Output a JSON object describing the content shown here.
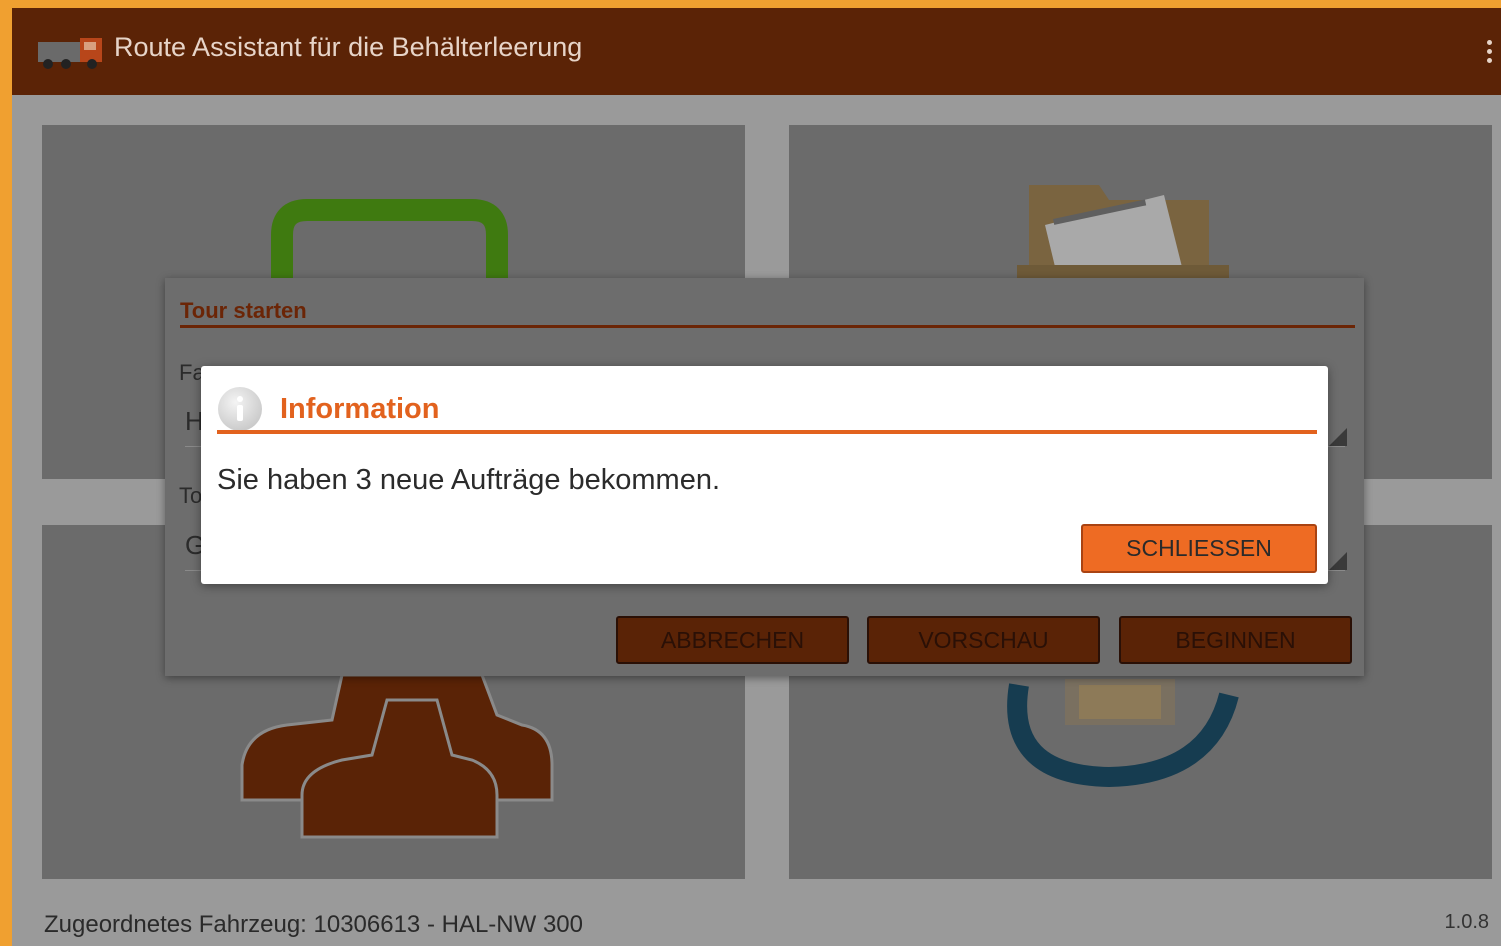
{
  "colors": {
    "appbar": "#5b2306",
    "accent": "#e2621e",
    "dimmed_button": "#5a2306",
    "tile": "#6b6b6b"
  },
  "appbar": {
    "title": "Route Assistant für die Behälterleerung",
    "icon": "garbage-truck-icon",
    "menu_icon": "overflow-menu-icon"
  },
  "tiles": [
    {
      "icon": "refresh-tour-icon"
    },
    {
      "icon": "folder-documents-icon"
    },
    {
      "icon": "users-icon"
    },
    {
      "icon": "sync-device-icon"
    }
  ],
  "tour_dialog": {
    "title": "Tour starten",
    "field1_label_partial": "Fa",
    "field1_value_partial": "H",
    "field2_label_partial": "To",
    "field2_value_partial": "G",
    "buttons": {
      "cancel": "ABBRECHEN",
      "preview": "VORSCHAU",
      "start": "BEGINNEN"
    }
  },
  "info_dialog": {
    "icon": "info-icon",
    "title": "Information",
    "message": "Sie haben 3 neue Aufträge bekommen.",
    "close_label": "SCHLIESSEN"
  },
  "footer": {
    "vehicle": "Zugeordnetes Fahrzeug: 10306613 - HAL-NW 300",
    "version": "1.0.8"
  }
}
